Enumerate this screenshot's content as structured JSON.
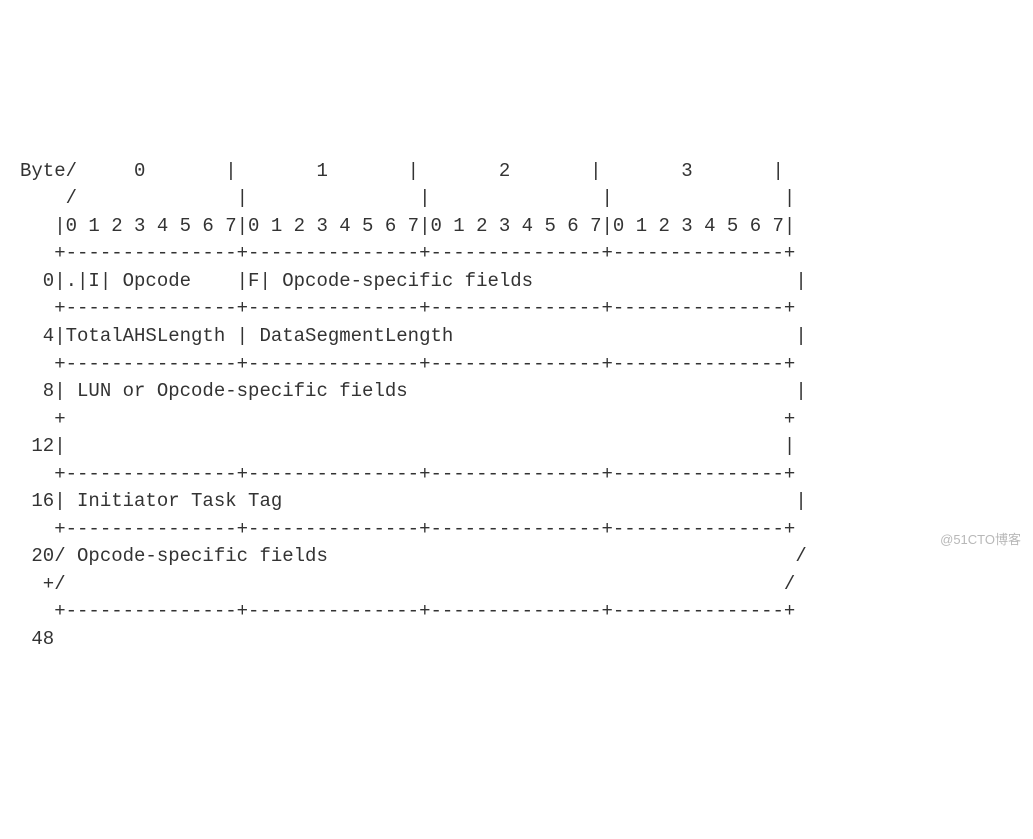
{
  "diagram": {
    "lines": [
      "Byte/     0       |       1       |       2       |       3       |",
      "    /              |               |               |               |",
      "   |0 1 2 3 4 5 6 7|0 1 2 3 4 5 6 7|0 1 2 3 4 5 6 7|0 1 2 3 4 5 6 7|",
      "   +---------------+---------------+---------------+---------------+",
      "  0|.|I| Opcode    |F| Opcode-specific fields                       |",
      "   +---------------+---------------+---------------+---------------+",
      "  4|TotalAHSLength | DataSegmentLength                              |",
      "   +---------------+---------------+---------------+---------------+",
      "  8| LUN or Opcode-specific fields                                  |",
      "   +                                                               +",
      " 12|                                                               |",
      "   +---------------+---------------+---------------+---------------+",
      " 16| Initiator Task Tag                                             |",
      "   +---------------+---------------+---------------+---------------+",
      " 20/ Opcode-specific fields                                         /",
      "  +/                                                               /",
      "   +---------------+---------------+---------------+---------------+",
      " 48"
    ]
  },
  "header": {
    "byte_columns": [
      "0",
      "1",
      "2",
      "3"
    ],
    "bit_labels": [
      "0",
      "1",
      "2",
      "3",
      "4",
      "5",
      "6",
      "7"
    ]
  },
  "fields": [
    {
      "offset": 0,
      "parts": [
        ".",
        "I",
        "Opcode",
        "F",
        "Opcode-specific fields"
      ]
    },
    {
      "offset": 4,
      "parts": [
        "TotalAHSLength",
        "DataSegmentLength"
      ]
    },
    {
      "offset": 8,
      "parts": [
        "LUN or Opcode-specific fields"
      ]
    },
    {
      "offset": 12,
      "parts": [
        ""
      ]
    },
    {
      "offset": 16,
      "parts": [
        "Initiator Task Tag"
      ]
    },
    {
      "offset": 20,
      "parts": [
        "Opcode-specific fields"
      ],
      "variable": true
    },
    {
      "offset": 48,
      "parts": []
    }
  ],
  "watermark": "@51CTO博客"
}
